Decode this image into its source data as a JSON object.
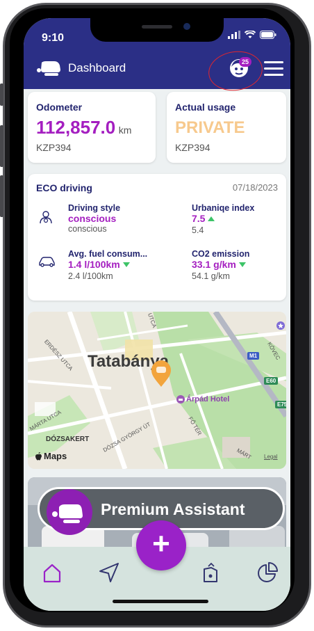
{
  "status_bar": {
    "time": "9:10"
  },
  "header": {
    "title": "Dashboard",
    "notifications_count": "25"
  },
  "odometer": {
    "title": "Odometer",
    "value": "112,857.0",
    "unit": "km",
    "plate": "KZP394"
  },
  "usage": {
    "title": "Actual usage",
    "value": "PRIVATE",
    "plate": "KZP394"
  },
  "eco": {
    "title": "ECO driving",
    "date": "07/18/2023",
    "driving_style": {
      "label": "Driving style",
      "value": "conscious",
      "sub": "conscious"
    },
    "urbaniqe": {
      "label": "Urbaniqe index",
      "value": "7.5",
      "sub": "5.4",
      "trend": "up"
    },
    "fuel": {
      "label": "Avg. fuel consum...",
      "value": "1.4 l/100km",
      "sub": "2.4 l/100km",
      "trend": "down"
    },
    "co2": {
      "label": "CO2 emission",
      "value": "33.1 g/km",
      "sub": "54.1 g/km",
      "trend": "down"
    }
  },
  "map": {
    "city": "Tatabánya",
    "poi": "Árpád Hotel",
    "labels": [
      "ERDÉSZ UTCA",
      "MÁRTA UTCA",
      "DÓZSAKERT",
      "DÓZSA GYÖRGY ÚT",
      "FŐ TÉR",
      "MÁRT",
      "KÖVEC",
      "UTCA"
    ],
    "road_badges": [
      "M1",
      "E60",
      "E75"
    ],
    "attribution": "Maps",
    "legal": "Legal"
  },
  "premium": {
    "label": "Premium Assistant"
  },
  "nav": {
    "fab_label": "+"
  },
  "colors": {
    "brand_navy": "#2b2f86",
    "accent_purple": "#a41ec0",
    "usage_orange": "#f7c98d",
    "trend_green": "#3dc468",
    "nav_bg": "#d5e3de"
  }
}
